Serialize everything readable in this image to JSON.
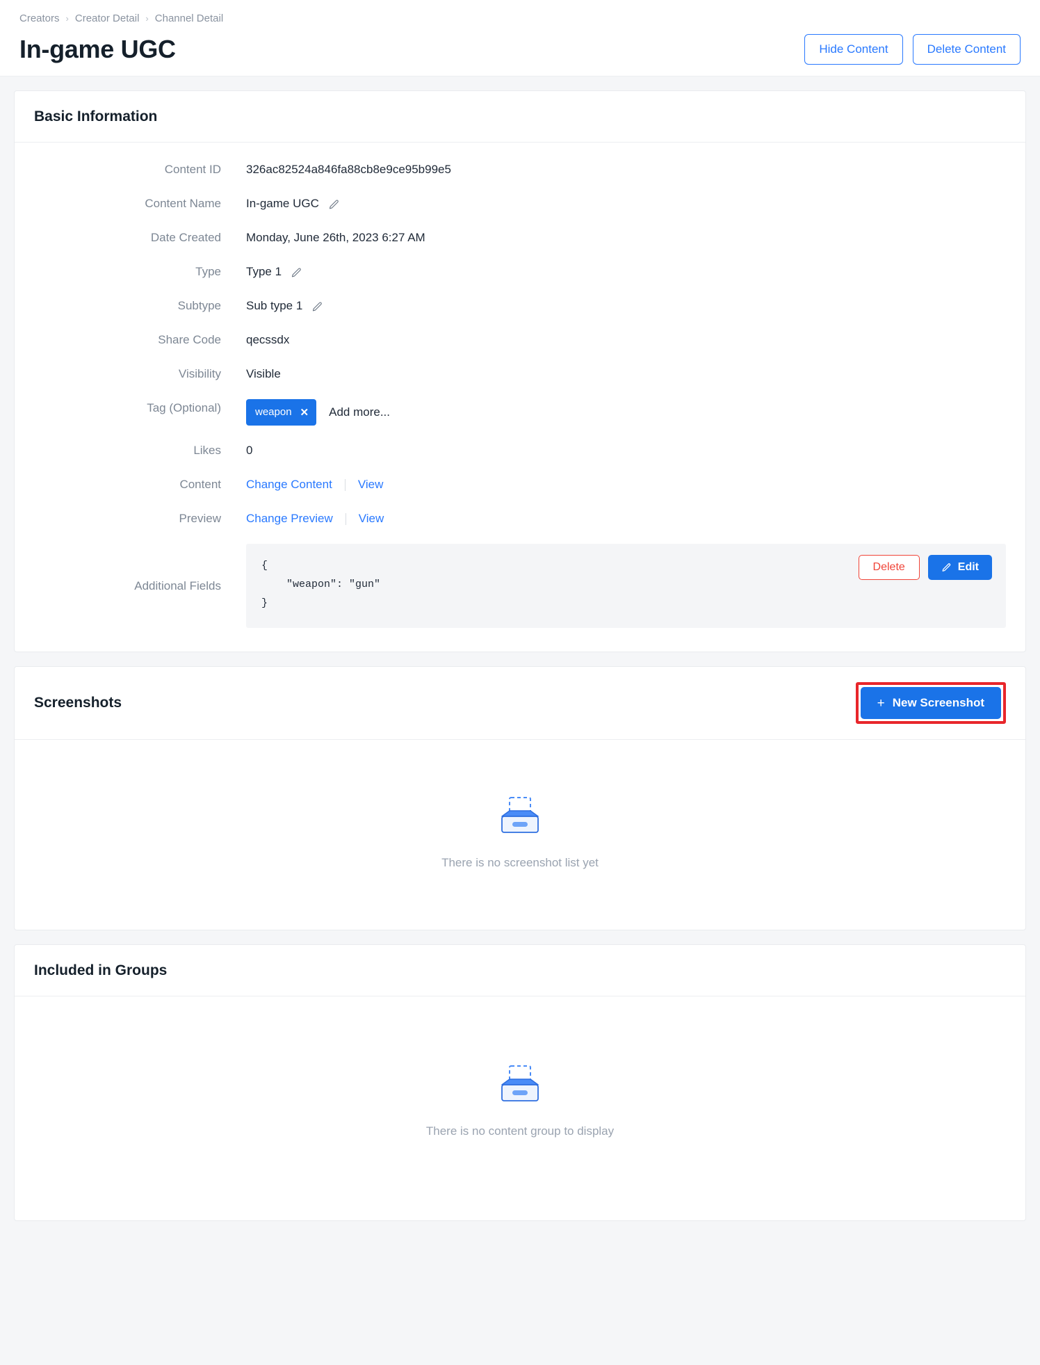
{
  "breadcrumb": {
    "items": [
      {
        "label": "Creators"
      },
      {
        "label": "Creator Detail"
      },
      {
        "label": "Channel Detail"
      }
    ],
    "separator": "›"
  },
  "header": {
    "title": "In-game UGC",
    "hide_content_label": "Hide Content",
    "delete_content_label": "Delete Content"
  },
  "basic_information": {
    "title": "Basic Information",
    "rows": {
      "content_id": {
        "label": "Content ID",
        "value": "326ac82524a846fa88cb8e9ce95b99e5"
      },
      "content_name": {
        "label": "Content Name",
        "value": "In-game UGC",
        "edit_icon": "pencil-icon"
      },
      "date_created": {
        "label": "Date Created",
        "value": "Monday, June 26th, 2023 6:27 AM"
      },
      "type": {
        "label": "Type",
        "value": "Type 1",
        "edit_icon": "pencil-icon"
      },
      "subtype": {
        "label": "Subtype",
        "value": "Sub type 1",
        "edit_icon": "pencil-icon"
      },
      "share_code": {
        "label": "Share Code",
        "value": "qecssdx"
      },
      "visibility": {
        "label": "Visibility",
        "value": "Visible"
      },
      "tag": {
        "label": "Tag (Optional)",
        "chip": "weapon",
        "chip_remove": "✕",
        "add_more": "Add more..."
      },
      "likes": {
        "label": "Likes",
        "value": "0"
      },
      "content": {
        "label": "Content",
        "change_link": "Change Content",
        "view_link": "View"
      },
      "preview": {
        "label": "Preview",
        "change_link": "Change Preview",
        "view_link": "View"
      },
      "additional_fields": {
        "label": "Additional Fields",
        "json": "{\n    \"weapon\": \"gun\"\n}",
        "delete_label": "Delete",
        "edit_label": "Edit"
      }
    }
  },
  "screenshots": {
    "title": "Screenshots",
    "new_button_label": "New Screenshot",
    "new_button_plus": "+",
    "empty_text": "There is no screenshot list yet",
    "empty_icon": "empty-inbox-icon",
    "highlighted": true
  },
  "included_in_groups": {
    "title": "Included in Groups",
    "empty_text": "There is no content group to display",
    "empty_icon": "empty-inbox-icon"
  },
  "colors": {
    "accent_blue": "#1a73e8",
    "link_blue": "#2979ff",
    "danger_red": "#f04438",
    "highlight_red": "#e8262b",
    "label_gray": "#7d8794",
    "page_bg": "#f5f6f8"
  }
}
